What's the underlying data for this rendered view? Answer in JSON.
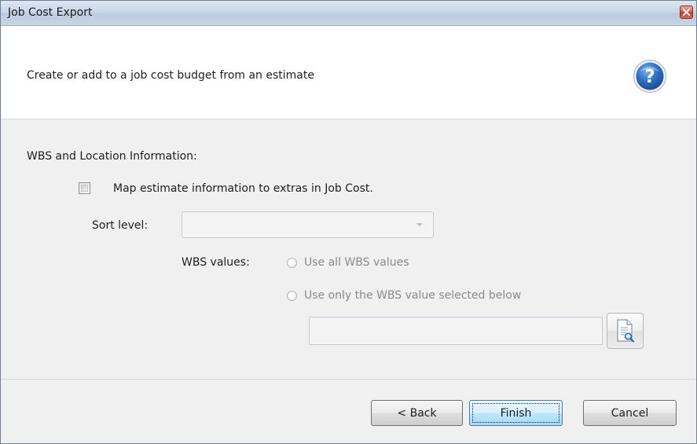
{
  "window": {
    "title": "Job Cost Export"
  },
  "header": {
    "description": "Create or add to a job cost budget from an estimate",
    "help_icon": "question-mark-circle-icon"
  },
  "section": {
    "heading": "WBS and Location Information:",
    "map_checkbox": {
      "label": "Map estimate information to extras in Job Cost.",
      "checked": false
    },
    "sort_level": {
      "label": "Sort level:",
      "value": ""
    },
    "wbs_values": {
      "label": "WBS values:",
      "options": [
        {
          "label": "Use all WBS values",
          "selected": false
        },
        {
          "label": "Use only the WBS value selected below",
          "selected": false
        }
      ],
      "selected_value": "",
      "browse_icon": "document-search-icon"
    }
  },
  "footer": {
    "back_label": "< Back",
    "finish_label": "Finish",
    "cancel_label": "Cancel"
  },
  "colors": {
    "title_bar": "#c9d7e7",
    "panel_bg": "#f0f0f0",
    "default_button": "#bee6fd",
    "close_button": "#c23b2e"
  }
}
